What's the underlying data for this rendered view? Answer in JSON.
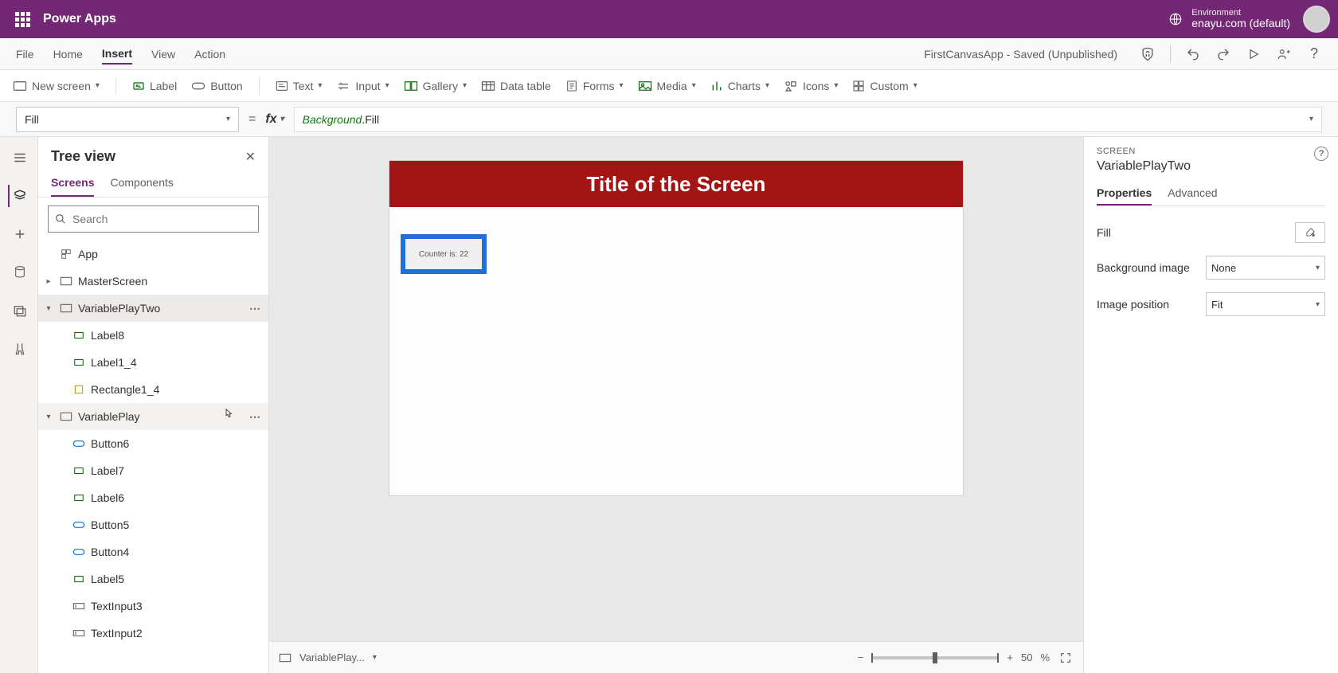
{
  "titlebar": {
    "brand": "Power Apps",
    "env_label": "Environment",
    "env_name": "enayu.com (default)"
  },
  "menubar": {
    "items": [
      "File",
      "Home",
      "Insert",
      "View",
      "Action"
    ],
    "active_index": 2,
    "doc_status": "FirstCanvasApp - Saved (Unpublished)"
  },
  "ribbon": {
    "new_screen": "New screen",
    "label": "Label",
    "button": "Button",
    "text": "Text",
    "input": "Input",
    "gallery": "Gallery",
    "data_table": "Data table",
    "forms": "Forms",
    "media": "Media",
    "charts": "Charts",
    "icons": "Icons",
    "custom": "Custom"
  },
  "formula": {
    "property": "Fill",
    "eq": "=",
    "fx": "fx",
    "token1": "Background",
    "token2": ".Fill"
  },
  "tree": {
    "title": "Tree view",
    "tabs": {
      "screens": "Screens",
      "components": "Components"
    },
    "search_placeholder": "Search",
    "nodes": {
      "app": "App",
      "master": "MasterScreen",
      "vpt": "VariablePlayTwo",
      "label8": "Label8",
      "label1_4": "Label1_4",
      "rect1_4": "Rectangle1_4",
      "vp": "VariablePlay",
      "button6": "Button6",
      "label7": "Label7",
      "label6": "Label6",
      "button5": "Button5",
      "button4": "Button4",
      "label5": "Label5",
      "ti3": "TextInput3",
      "ti2": "TextInput2"
    }
  },
  "canvas": {
    "title": "Title of the Screen",
    "counter": "Counter is: 22",
    "footer": {
      "screen_name": "VariablePlay...",
      "zoom_value": "50",
      "zoom_unit": "%",
      "minus": "−",
      "plus": "+"
    }
  },
  "prop_panel": {
    "type_label": "SCREEN",
    "name": "VariablePlayTwo",
    "tabs": {
      "properties": "Properties",
      "advanced": "Advanced"
    },
    "fill_label": "Fill",
    "bg_label": "Background image",
    "bg_value": "None",
    "imgpos_label": "Image position",
    "imgpos_value": "Fit"
  }
}
